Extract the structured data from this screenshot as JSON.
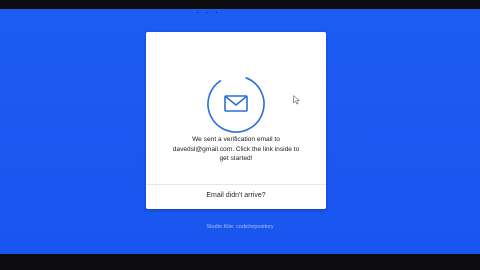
{
  "card": {
    "message_line1": "We sent a verification email to",
    "message_line2": "davedsl@gmail.com. Click the link inside to",
    "message_line3": "get started!",
    "resend_link": "Email didn't arrive?"
  },
  "footer": {
    "text": "Studio Kite: code/repository"
  },
  "colors": {
    "background": "#1a58f2",
    "card": "#ffffff",
    "accent": "#2a6fd8"
  },
  "icons": {
    "envelope": "envelope-icon",
    "cursor": "mouse-pointer-icon"
  }
}
